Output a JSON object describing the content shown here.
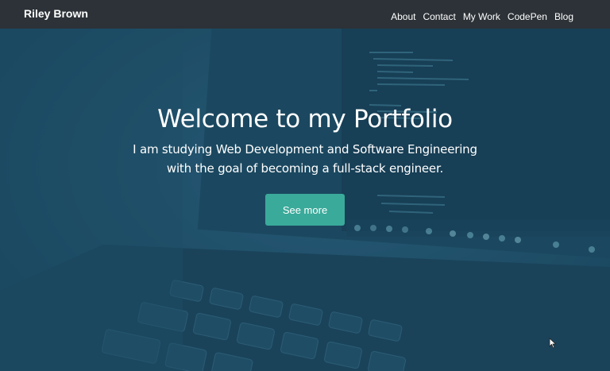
{
  "navbar": {
    "brand": "Riley Brown",
    "links": [
      "About",
      "Contact",
      "My Work",
      "CodePen",
      "Blog"
    ]
  },
  "hero": {
    "title": "Welcome to my Portfolio",
    "subtitle": "I am studying Web Development and Software Engineering with the goal of becoming a full-stack engineer.",
    "cta_label": "See more"
  },
  "colors": {
    "navbar_bg": "#2c3237",
    "hero_tint": "#1f4d66",
    "cta_bg": "#3aaa9a",
    "text": "#ffffff"
  }
}
